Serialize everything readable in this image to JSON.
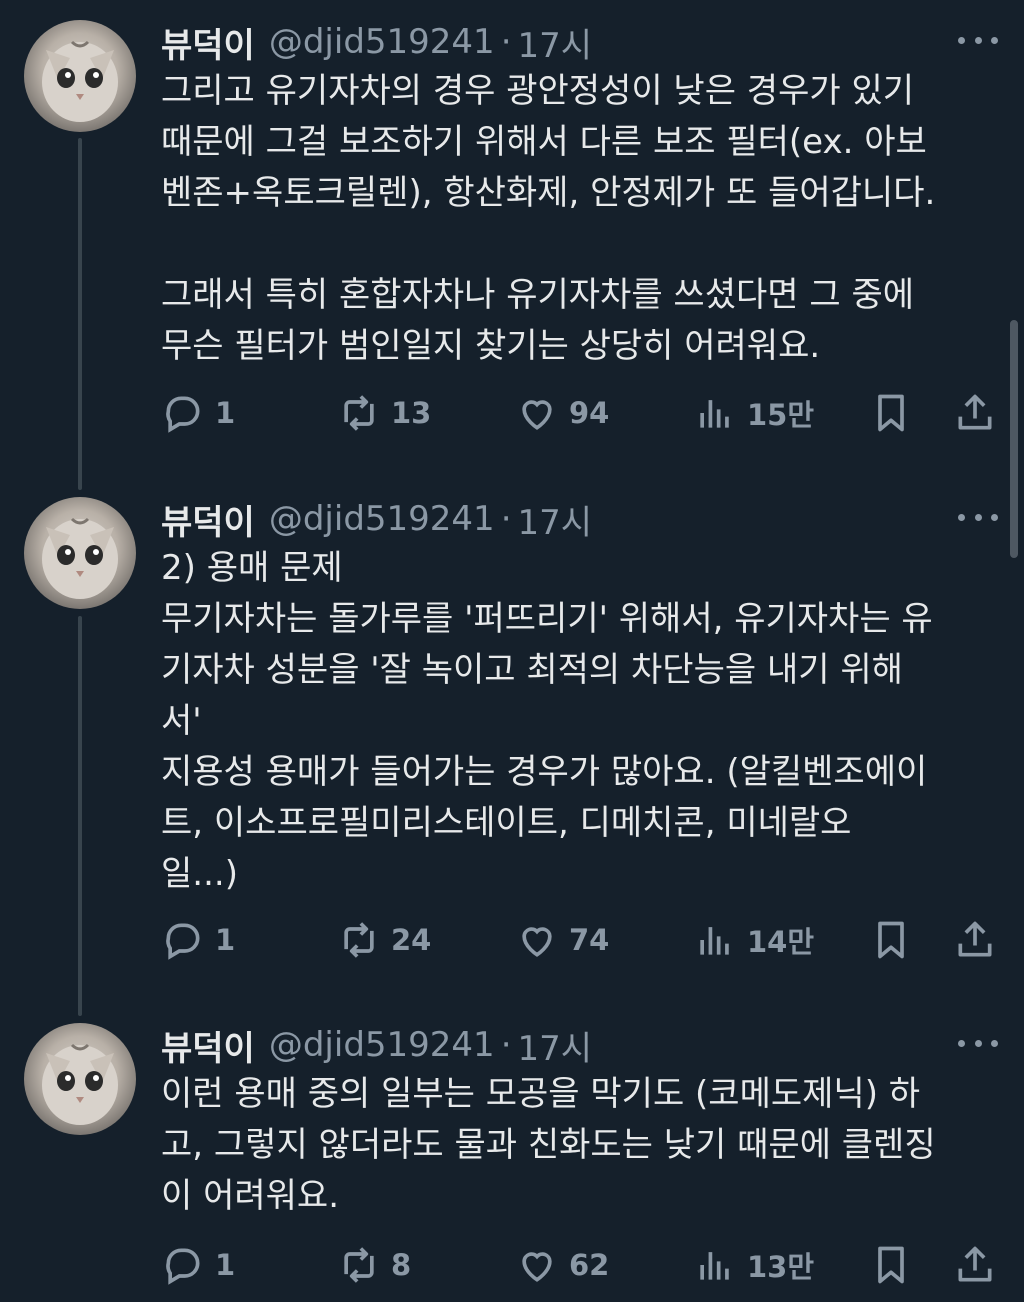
{
  "tweets": [
    {
      "name": "뷰덕이",
      "handle": "@djid519241",
      "separator": "·",
      "time": "17시",
      "lines": [
        "그리고 유기자차의 경우 광안정성이 낮은 경우가 있기",
        "때문에 그걸 보조하기 위해서 다른 보조 필터(ex. 아보",
        "벤존+옥토크릴렌), 항산화제, 안정제가 또 들어갑니다.",
        "",
        "그래서 특히 혼합자차나 유기자차를 쓰셨다면 그 중에",
        "무슨 필터가 범인일지 찾기는 상당히 어려워요."
      ],
      "replies": "1",
      "retweets": "13",
      "likes": "94",
      "views": "15만"
    },
    {
      "name": "뷰덕이",
      "handle": "@djid519241",
      "separator": "·",
      "time": "17시",
      "lines": [
        "2) 용매 문제",
        "무기자차는 돌가루를 '퍼뜨리기' 위해서, 유기자차는 유",
        "기자차 성분을 '잘 녹이고 최적의 차단능을 내기 위해",
        "서'",
        "지용성 용매가 들어가는 경우가 많아요. (알킬벤조에이",
        "트, 이소프로필미리스테이트, 디메치콘, 미네랄오",
        "일...)"
      ],
      "replies": "1",
      "retweets": "24",
      "likes": "74",
      "views": "14만"
    },
    {
      "name": "뷰덕이",
      "handle": "@djid519241",
      "separator": "·",
      "time": "17시",
      "lines": [
        "이런 용매 중의 일부는 모공을 막기도 (코메도제닉) 하",
        "고, 그렇지 않더라도 물과 친화도는 낮기 때문에 클렌징",
        "이 어려워요."
      ],
      "replies": "1",
      "retweets": "8",
      "likes": "62",
      "views": "13만"
    }
  ],
  "colors": {
    "background": "#15202b",
    "text": "#e7e9ea",
    "muted": "#8b98a5",
    "thread_line": "#38444d"
  },
  "icons": [
    "reply-icon",
    "retweet-icon",
    "like-icon",
    "views-icon",
    "bookmark-icon",
    "share-icon",
    "more-icon"
  ]
}
